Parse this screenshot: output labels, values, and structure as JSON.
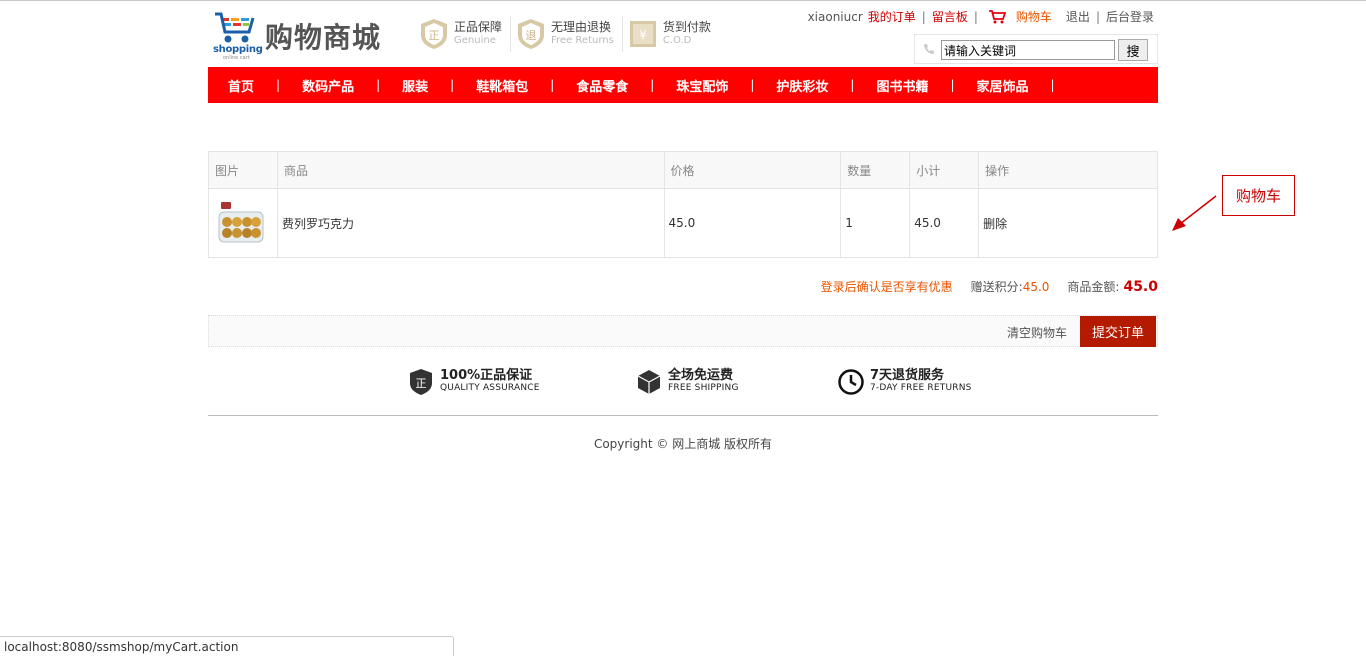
{
  "header": {
    "logo_sub": "shopping",
    "logo_sub2": "online cart",
    "logo_title": "购物商城",
    "badges": [
      {
        "title": "正品保障",
        "sub": "Genuine",
        "icon": "genuine-shield-icon"
      },
      {
        "title": "无理由退换",
        "sub": "Free Returns",
        "icon": "returns-shield-icon"
      },
      {
        "title": "货到付款",
        "sub": "C.O.D",
        "icon": "cod-box-icon"
      }
    ],
    "links": {
      "username": "xiaoniucr",
      "my_orders": "我的订单",
      "message_board": "留言板",
      "cart": "购物车",
      "logout": "退出",
      "admin_login": "后台登录"
    },
    "search": {
      "value": "请输入关键词",
      "button": "搜"
    }
  },
  "nav": [
    "首页",
    "数码产品",
    "服装",
    "鞋靴箱包",
    "食品零食",
    "珠宝配饰",
    "护肤彩妆",
    "图书书籍",
    "家居饰品"
  ],
  "cart": {
    "columns": [
      "图片",
      "商品",
      "价格",
      "数量",
      "小计",
      "操作"
    ],
    "rows": [
      {
        "name": "费列罗巧克力",
        "price": "45.0",
        "qty": "1",
        "subtotal": "45.0",
        "action": "删除"
      }
    ],
    "promo": "登录后确认是否享有优惠",
    "points_label": "赠送积分:",
    "points": "45.0",
    "amount_label": "商品金额:",
    "amount": "45.0",
    "clear": "清空购物车",
    "submit": "提交订单"
  },
  "guarantees": [
    {
      "title": "100%正品保证",
      "sub": "QUALITY ASSURANCE",
      "icon": "quality-shield-icon"
    },
    {
      "title": "全场免运费",
      "sub": "FREE SHIPPING",
      "icon": "shipping-box-icon"
    },
    {
      "title": "7天退货服务",
      "sub": "7-DAY FREE RETURNS",
      "icon": "clock-icon"
    }
  ],
  "copyright": "Copyright © 网上商城 版权所有",
  "annotation": "购物车",
  "status_url": "localhost:8080/ssmshop/myCart.action",
  "colors": {
    "nav_bg": "#ff0000",
    "submit_bg": "#b31a00",
    "accent_orange": "#e95500",
    "price_red": "#cc0000"
  }
}
